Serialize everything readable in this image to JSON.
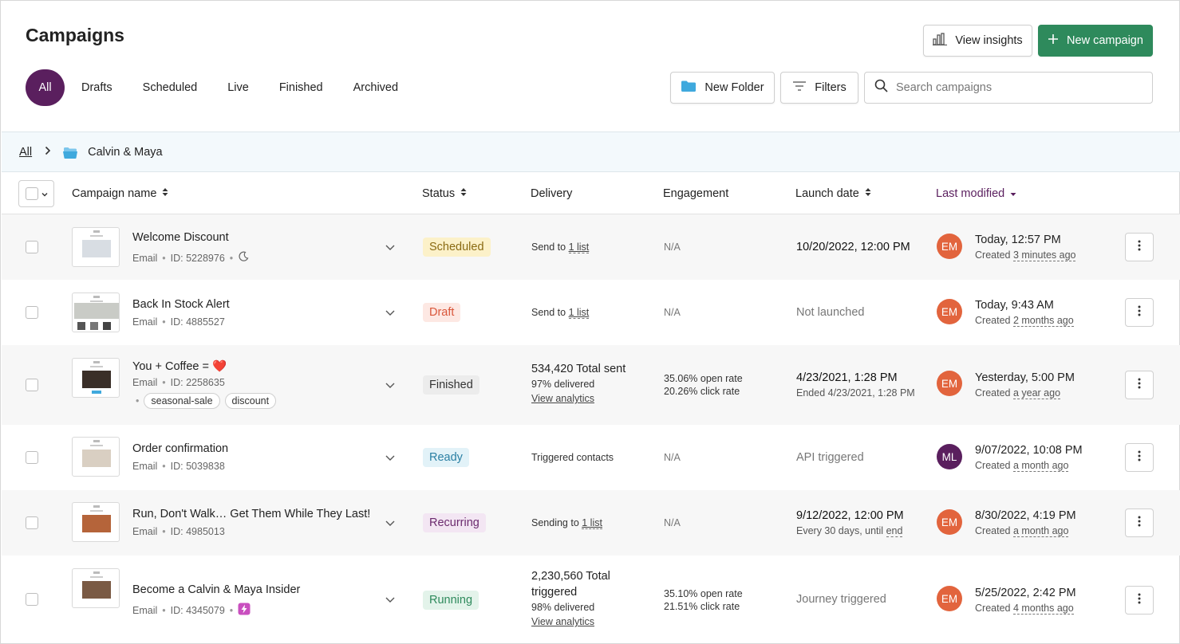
{
  "header": {
    "title": "Campaigns",
    "view_insights_label": "View insights",
    "new_campaign_label": "New campaign"
  },
  "tabs": [
    {
      "label": "All",
      "active": true
    },
    {
      "label": "Drafts"
    },
    {
      "label": "Scheduled"
    },
    {
      "label": "Live"
    },
    {
      "label": "Finished"
    },
    {
      "label": "Archived"
    }
  ],
  "toolbar": {
    "new_folder_label": "New Folder",
    "filters_label": "Filters",
    "search_placeholder": "Search campaigns"
  },
  "breadcrumb": {
    "root": "All",
    "folder": "Calvin & Maya"
  },
  "columns": {
    "name": "Campaign name",
    "status": "Status",
    "delivery": "Delivery",
    "engagement": "Engagement",
    "launch": "Launch date",
    "modified": "Last modified"
  },
  "colors": {
    "primary": "#5a1f5e",
    "accent_green": "#2e8a5c",
    "avatar_orange": "#e2643d"
  },
  "rows": [
    {
      "name": "Welcome Discount",
      "type": "Email",
      "id": "ID: 5228976",
      "status": "Scheduled",
      "delivery_prefix": "Send to ",
      "delivery_link": "1 list",
      "engagement": "N/A",
      "launch": "10/20/2022, 12:00 PM",
      "initials": "EM",
      "modified": "Today, 12:57 PM",
      "created_prefix": "Created ",
      "created": "3 minutes ago"
    },
    {
      "name": "Back In Stock Alert",
      "type": "Email",
      "id": "ID: 4885527",
      "status": "Draft",
      "delivery_prefix": "Send to ",
      "delivery_link": "1 list",
      "engagement": "N/A",
      "launch": "Not launched",
      "initials": "EM",
      "modified": "Today, 9:43 AM",
      "created_prefix": "Created ",
      "created": "2 months ago"
    },
    {
      "name": "You + Coffee = ❤️",
      "type": "Email",
      "id": "ID: 2258635",
      "tags": [
        "seasonal-sale",
        "discount"
      ],
      "status": "Finished",
      "delivery_total": "534,420 Total sent",
      "delivery_rate": "97% delivered",
      "delivery_analytics": "View analytics",
      "open_rate": "35.06% open rate",
      "click_rate": "20.26% click rate",
      "launch": "4/23/2021, 1:28 PM",
      "launch_sub": "Ended 4/23/2021, 1:28 PM",
      "initials": "EM",
      "modified": "Yesterday, 5:00 PM",
      "created_prefix": "Created ",
      "created": "a year ago"
    },
    {
      "name": "Order confirmation",
      "type": "Email",
      "id": "ID: 5039838",
      "status": "Ready",
      "delivery_text": "Triggered contacts",
      "engagement": "N/A",
      "launch": "API triggered",
      "initials": "ML",
      "modified": "9/07/2022, 10:08 PM",
      "created_prefix": "Created ",
      "created": "a month ago"
    },
    {
      "name": "Run, Don't Walk… Get Them While They Last!",
      "type": "Email",
      "id": "ID: 4985013",
      "status": "Recurring",
      "delivery_prefix": "Sending to ",
      "delivery_link": "1 list",
      "engagement": "N/A",
      "launch": "9/12/2022, 12:00 PM",
      "launch_sub_prefix": "Every 30 days, until ",
      "launch_sub_link": "end",
      "initials": "EM",
      "modified": "8/30/2022, 4:19 PM",
      "created_prefix": "Created ",
      "created": "a month ago"
    },
    {
      "name": "Become a Calvin & Maya Insider",
      "type": "Email",
      "id": "ID: 4345079",
      "status": "Running",
      "delivery_total_1": "2,230,560 Total",
      "delivery_total_2": "triggered",
      "delivery_rate": "98% delivered",
      "delivery_analytics": "View analytics",
      "open_rate": "35.10% open rate",
      "click_rate": "21.51% click rate",
      "launch": "Journey triggered",
      "initials": "EM",
      "modified": "5/25/2022, 2:42 PM",
      "created_prefix": "Created ",
      "created": "4 months ago"
    }
  ]
}
